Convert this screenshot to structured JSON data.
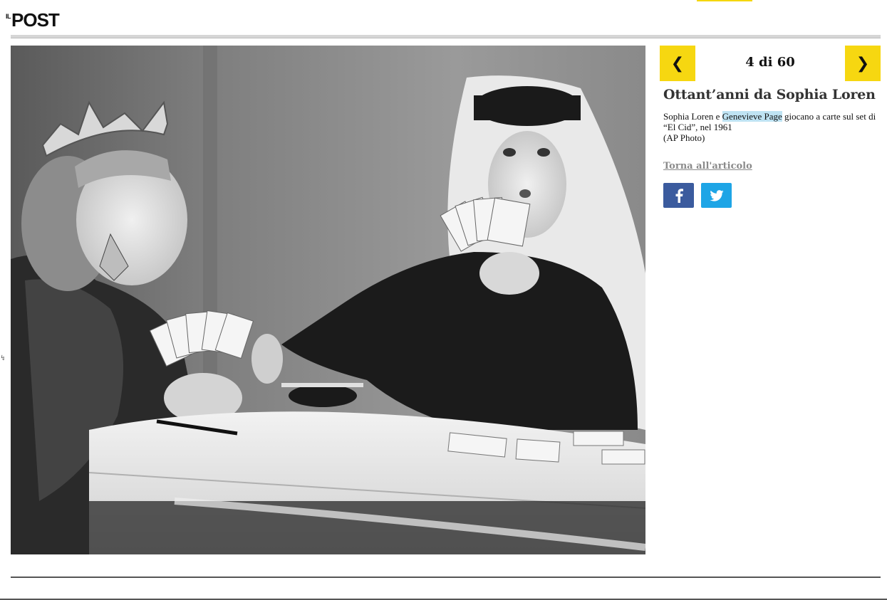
{
  "logo": {
    "prefix": "IL",
    "word": "POST"
  },
  "gallery": {
    "prev_label": "❮",
    "next_label": "❯",
    "counter": "4 di 60",
    "title": "Ottant’anni da Sophia Loren",
    "caption_before": "Sophia Loren e ",
    "caption_highlight": "Genevieve Page",
    "caption_after": " giocano a carte sul set di “El Cid”, nel 1961",
    "credit": "(AP Photo)",
    "back_link": "Torna all'articolo"
  },
  "photo": {
    "description_icon": "black-and-white-photo",
    "colors": {
      "tone_dark": "#1a1a1a",
      "tone_light": "#e8e8e8"
    }
  },
  "share": {
    "facebook_icon": "facebook-icon",
    "twitter_icon": "twitter-icon"
  },
  "colors": {
    "accent_yellow": "#f6d711",
    "facebook_blue": "#3b5b9e",
    "twitter_blue": "#1ea5e6",
    "link_gray": "#8a8a8a",
    "highlight": "#bfe3f3"
  }
}
